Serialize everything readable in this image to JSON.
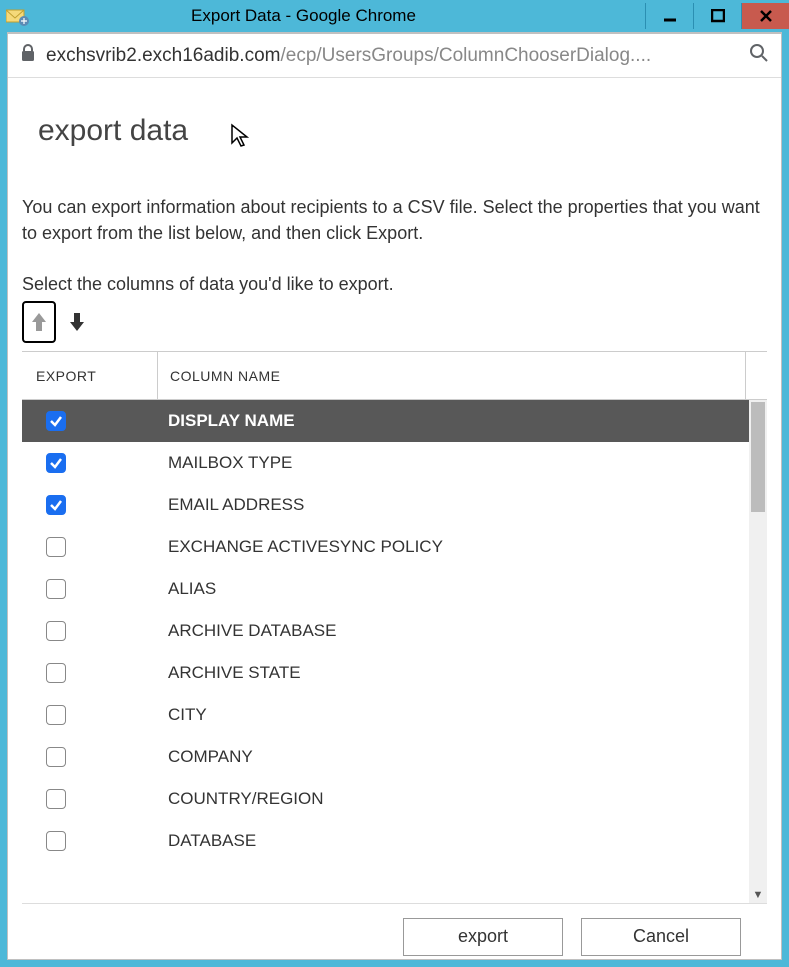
{
  "window": {
    "title": "Export Data - Google Chrome"
  },
  "address": {
    "domain": "exchsvrib2.exch16adib.com",
    "path": "/ecp/UsersGroups/ColumnChooserDialog...."
  },
  "page": {
    "title": "export data",
    "description": "You can export information about recipients to a CSV file. Select the properties that you want to export from the list below, and then click Export.",
    "select_label": "Select the columns of data you'd like to export."
  },
  "table": {
    "headers": {
      "export": "EXPORT",
      "column_name": "COLUMN NAME"
    },
    "rows": [
      {
        "label": "DISPLAY NAME",
        "checked": true,
        "selected": true
      },
      {
        "label": "MAILBOX TYPE",
        "checked": true,
        "selected": false
      },
      {
        "label": "EMAIL ADDRESS",
        "checked": true,
        "selected": false
      },
      {
        "label": "EXCHANGE ACTIVESYNC POLICY",
        "checked": false,
        "selected": false
      },
      {
        "label": "ALIAS",
        "checked": false,
        "selected": false
      },
      {
        "label": "ARCHIVE DATABASE",
        "checked": false,
        "selected": false
      },
      {
        "label": "ARCHIVE STATE",
        "checked": false,
        "selected": false
      },
      {
        "label": "CITY",
        "checked": false,
        "selected": false
      },
      {
        "label": "COMPANY",
        "checked": false,
        "selected": false
      },
      {
        "label": "COUNTRY/REGION",
        "checked": false,
        "selected": false
      },
      {
        "label": "DATABASE",
        "checked": false,
        "selected": false
      }
    ]
  },
  "footer": {
    "export_label": "export",
    "cancel_label": "Cancel"
  }
}
